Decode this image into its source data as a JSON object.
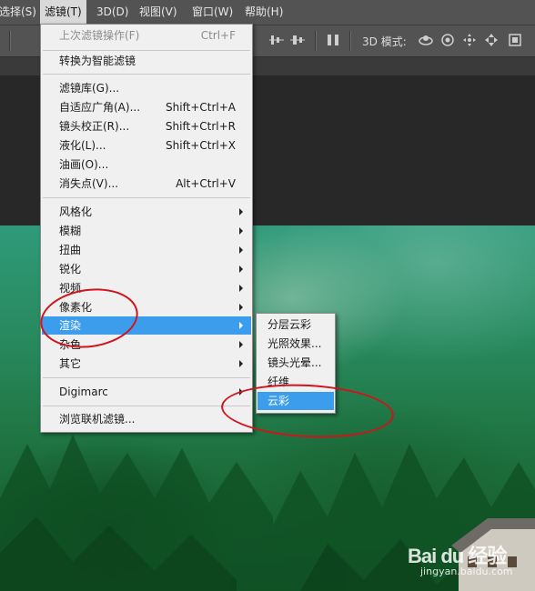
{
  "menubar": {
    "items": [
      {
        "label": "选择(S)"
      },
      {
        "label": "滤镜(T)",
        "active": true
      },
      {
        "label": "3D(D)"
      },
      {
        "label": "视图(V)"
      },
      {
        "label": "窗口(W)"
      },
      {
        "label": "帮助(H)"
      }
    ]
  },
  "options_bar": {
    "mode_label": "3D 模式:",
    "icons": [
      "align-icon",
      "distribute-icon",
      "orbit-icon",
      "roll-icon",
      "pan-icon",
      "slide-icon",
      "scale-icon"
    ]
  },
  "filter_menu": {
    "last_filter": {
      "label": "上次滤镜操作(F)",
      "shortcut": "Ctrl+F"
    },
    "convert_smart": {
      "label": "转换为智能滤镜"
    },
    "gallery": {
      "label": "滤镜库(G)..."
    },
    "adaptive_wide": {
      "label": "自适应广角(A)...",
      "shortcut": "Shift+Ctrl+A"
    },
    "lens_correction": {
      "label": "镜头校正(R)...",
      "shortcut": "Shift+Ctrl+R"
    },
    "liquify": {
      "label": "液化(L)...",
      "shortcut": "Shift+Ctrl+X"
    },
    "oil_paint": {
      "label": "油画(O)..."
    },
    "vanishing_point": {
      "label": "消失点(V)...",
      "shortcut": "Alt+Ctrl+V"
    },
    "stylize": {
      "label": "风格化"
    },
    "blur": {
      "label": "模糊"
    },
    "distort": {
      "label": "扭曲"
    },
    "sharpen": {
      "label": "锐化"
    },
    "video": {
      "label": "视频"
    },
    "pixelate": {
      "label": "像素化"
    },
    "render": {
      "label": "渲染"
    },
    "noise": {
      "label": "杂色"
    },
    "other": {
      "label": "其它"
    },
    "digimarc": {
      "label": "Digimarc"
    },
    "browse_online": {
      "label": "浏览联机滤镜..."
    }
  },
  "render_submenu": {
    "difference_clouds": {
      "label": "分层云彩"
    },
    "lighting_effects": {
      "label": "光照效果..."
    },
    "lens_flare": {
      "label": "镜头光晕..."
    },
    "fibers": {
      "label": "纤维"
    },
    "clouds": {
      "label": "云彩"
    }
  },
  "watermark": {
    "brand": "Bai du 经验",
    "url": "jingyan.baidu.com"
  },
  "colors": {
    "highlight": "#3c9dec",
    "annotation": "#d0141a",
    "menu_bg": "#f0f0f0"
  }
}
